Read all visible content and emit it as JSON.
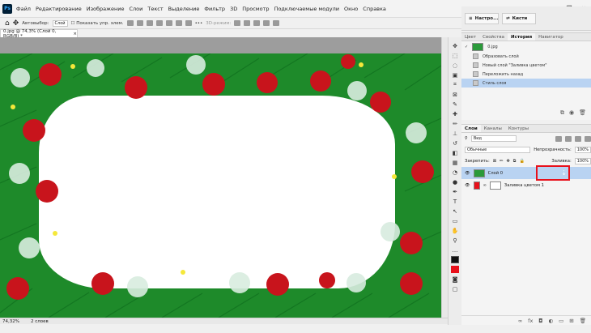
{
  "app": {
    "logo": "Ps"
  },
  "menu": [
    "Файл",
    "Редактирование",
    "Изображение",
    "Слои",
    "Текст",
    "Выделение",
    "Фильтр",
    "3D",
    "Просмотр",
    "Подключаемые модули",
    "Окно",
    "Справка"
  ],
  "window_controls": [
    "—",
    "❐",
    "✕"
  ],
  "options": {
    "autoselect_label": "Автовыбор:",
    "autoselect_value": "Слой",
    "show_transform_label": "Показать упр. элем.",
    "mode_3d_label": "3D-режим:"
  },
  "doc_tab": {
    "title": "0.jpg @ 74,3% (Слой 0, RGB/8) *",
    "close": "×"
  },
  "status": {
    "zoom": "74,32%",
    "layers": "2 слоев"
  },
  "top_panel": {
    "btn1": "Настро...",
    "btn2": "Кисти"
  },
  "history_panel": {
    "tabs": [
      "Цвет",
      "Свойства",
      "История",
      "Навигатор"
    ],
    "active_tab": "История",
    "snapshot": "0.jpg",
    "steps": [
      "Образовать слой",
      "Новый слой \"Заливка цветом\"",
      "Переложить назад",
      "Стиль слоя"
    ]
  },
  "layers_panel": {
    "tabs": [
      "Слои",
      "Каналы",
      "Контуры"
    ],
    "active_tab": "Слои",
    "filter_label": "Вид",
    "blend_mode": "Обычные",
    "opacity_label": "Непрозрачность:",
    "opacity_value": "100%",
    "lock_label": "Закрепить:",
    "fill_label": "Заливка:",
    "fill_value": "100%",
    "layers": [
      {
        "name": "Слой 0",
        "selected": true
      },
      {
        "name": "Заливка цветом 1",
        "selected": false
      }
    ],
    "bottom_icons": [
      "link-icon",
      "fx-icon",
      "mask-icon",
      "adjustment-icon",
      "group-icon",
      "new-layer-icon",
      "trash-icon"
    ]
  },
  "colors": {
    "accent": "#e8111b",
    "selection": "#b9d3f2",
    "ornament_red": "#c8141c",
    "pine": "#1e8a2a"
  }
}
